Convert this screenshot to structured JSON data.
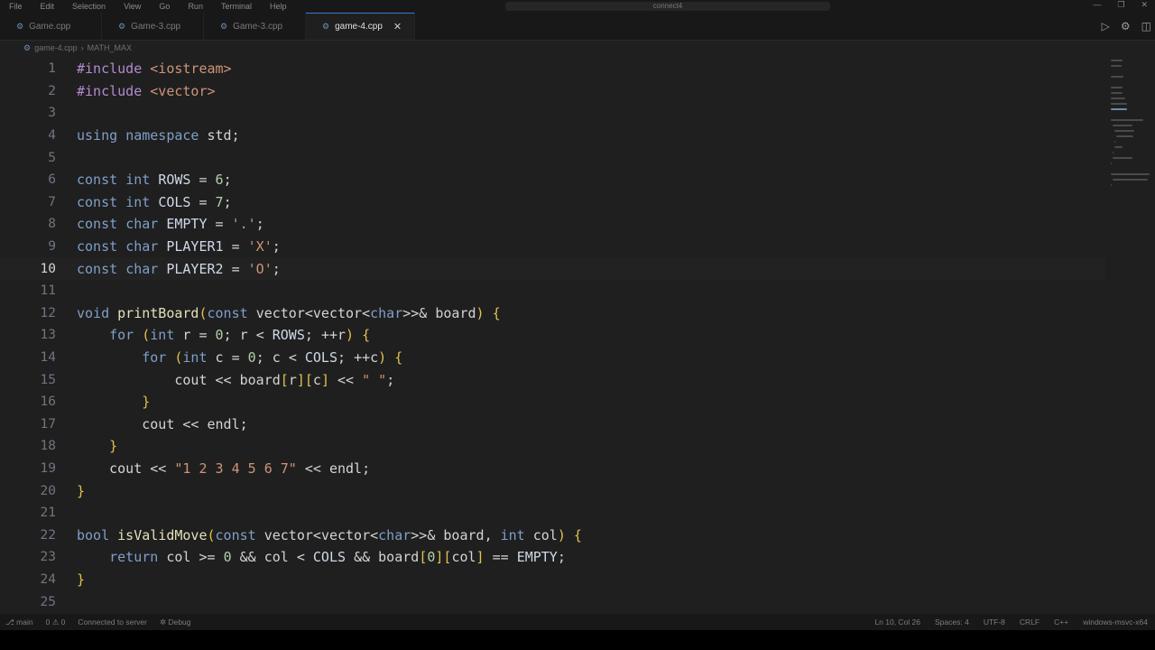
{
  "menu": {
    "items": [
      "File",
      "Edit",
      "Selection",
      "View",
      "Go",
      "Run",
      "Terminal",
      "Help"
    ],
    "search_placeholder": "connect4",
    "controls": [
      "—",
      "❐",
      "✕"
    ]
  },
  "tabs": [
    {
      "label": "Game.cpp",
      "active": false
    },
    {
      "label": "Game-3.cpp",
      "active": false
    },
    {
      "label": "Game-3.cpp",
      "active": false
    },
    {
      "label": "game-4.cpp",
      "active": true
    }
  ],
  "breadcrumb": {
    "file": "game-4.cpp",
    "separator": "›",
    "symbol": "MATH_MAX"
  },
  "editor": {
    "current_line": 10,
    "lines": [
      {
        "n": "1",
        "text": "#include <iostream>"
      },
      {
        "n": "2",
        "text": "#include <vector>"
      },
      {
        "n": "3",
        "text": ""
      },
      {
        "n": "4",
        "text": "using namespace std;"
      },
      {
        "n": "5",
        "text": ""
      },
      {
        "n": "6",
        "text": "const int ROWS = 6;"
      },
      {
        "n": "7",
        "text": "const int COLS = 7;"
      },
      {
        "n": "8",
        "text": "const char EMPTY = '.';"
      },
      {
        "n": "9",
        "text": "const char PLAYER1 = 'X';"
      },
      {
        "n": "10",
        "text": "const char PLAYER2 = 'O';"
      },
      {
        "n": "11",
        "text": ""
      },
      {
        "n": "12",
        "text": "void printBoard(const vector<vector<char>>& board) {"
      },
      {
        "n": "13",
        "text": "    for (int r = 0; r < ROWS; ++r) {"
      },
      {
        "n": "14",
        "text": "        for (int c = 0; c < COLS; ++c) {"
      },
      {
        "n": "15",
        "text": "            cout << board[r][c] << \" \";"
      },
      {
        "n": "16",
        "text": "        }"
      },
      {
        "n": "17",
        "text": "        cout << endl;"
      },
      {
        "n": "18",
        "text": "    }"
      },
      {
        "n": "19",
        "text": "    cout << \"1 2 3 4 5 6 7\" << endl;"
      },
      {
        "n": "20",
        "text": "}"
      },
      {
        "n": "21",
        "text": ""
      },
      {
        "n": "22",
        "text": "bool isValidMove(const vector<vector<char>>& board, int col) {"
      },
      {
        "n": "23",
        "text": "    return col >= 0 && col < COLS && board[0][col] == EMPTY;"
      },
      {
        "n": "24",
        "text": "}"
      },
      {
        "n": "25",
        "text": ""
      }
    ]
  },
  "statusbar": {
    "branch": "main",
    "sync": "0 ⚠ 0",
    "remote": "Connected to server",
    "debug": "Debug",
    "position": "Ln 10, Col 26",
    "spaces": "Spaces: 4",
    "encoding": "UTF-8",
    "eol": "CRLF",
    "language": "C++",
    "platform": "windows-msvc-x64"
  },
  "colors": {
    "background": "#1f1f1f",
    "keyword": "#7f9fc8",
    "string": "#cf9478",
    "preprocessor": "#b58bd0",
    "function": "#e3e0b8"
  }
}
